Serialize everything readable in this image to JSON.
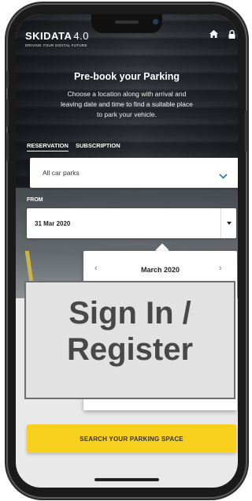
{
  "header": {
    "logo_text": "SKIDATA",
    "logo_version": "4.0",
    "tagline": "DRIVING YOUR DIGITAL FUTURE",
    "icons": [
      "home-icon",
      "lock-icon"
    ]
  },
  "hero": {
    "title": "Pre-book your Parking",
    "subtitle": "Choose a location along with arrival and leaving date and time to find a suitable place to park your vehicle."
  },
  "tabs": [
    {
      "label": "RESERVATION",
      "active": true
    },
    {
      "label": "SUBSCRIPTION",
      "active": false
    }
  ],
  "car_park_select": {
    "value": "All car parks"
  },
  "from_section": {
    "label": "FROM",
    "date_value": "31 Mar 2020"
  },
  "calendar": {
    "month_label": "March 2020"
  },
  "overlay": {
    "line1": "Sign In /",
    "line2": "Register"
  },
  "search_button": {
    "label": "SEARCH YOUR PARKING SPACE"
  },
  "colors": {
    "accent": "#f7cf1d",
    "chevron_blue": "#1e73be"
  }
}
